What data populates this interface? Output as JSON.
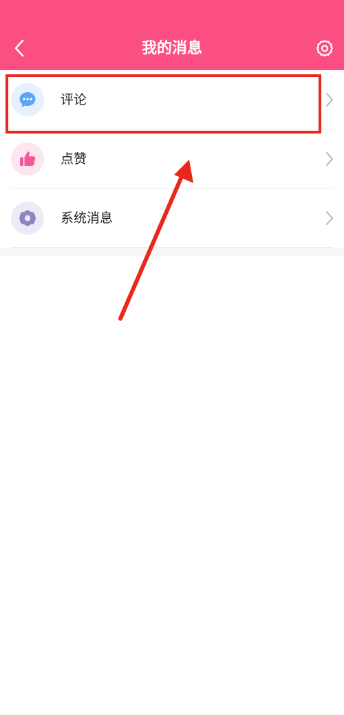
{
  "header": {
    "title": "我的消息",
    "background": "#fb4f82",
    "back_icon": "chevron-left-icon",
    "settings_icon": "gear-icon"
  },
  "list": {
    "items": [
      {
        "label": "评论",
        "icon": "comment-bubble-icon",
        "icon_bg": "#e6f1fd",
        "icon_color": "#5ea6f4"
      },
      {
        "label": "点赞",
        "icon": "thumbs-up-icon",
        "icon_bg": "#fde6ef",
        "icon_color": "#f5589a"
      },
      {
        "label": "系统消息",
        "icon": "gear-icon",
        "icon_bg": "#ecebf5",
        "icon_color": "#8c87c2"
      }
    ]
  },
  "annotation": {
    "color": "#e8281c",
    "highlighted_item": "评论"
  }
}
